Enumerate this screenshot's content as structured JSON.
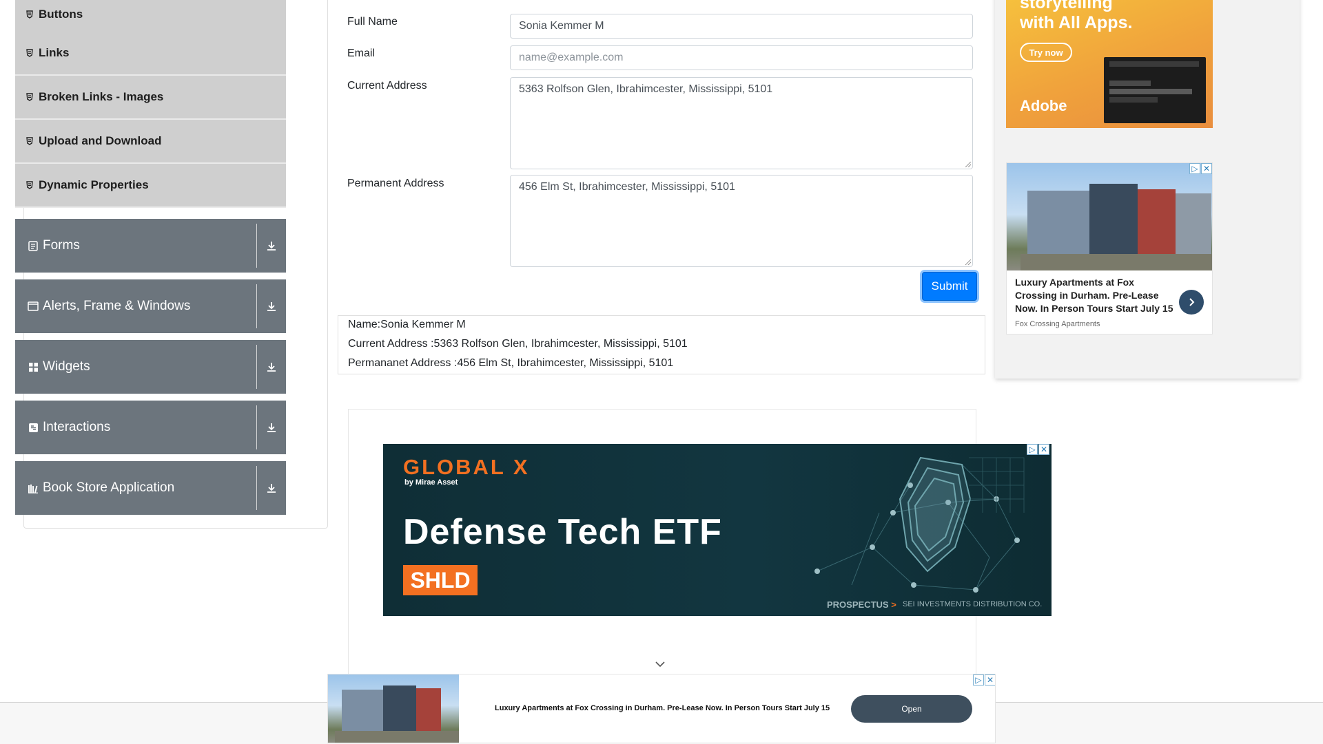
{
  "sidebar": {
    "elements_subitems": [
      {
        "label": "Buttons"
      },
      {
        "label": "Links"
      },
      {
        "label": "Broken Links - Images"
      },
      {
        "label": "Upload and Download"
      },
      {
        "label": "Dynamic Properties"
      }
    ],
    "groups": [
      {
        "label": "Forms",
        "icon": "form-icon"
      },
      {
        "label": "Alerts, Frame & Windows",
        "icon": "window-icon"
      },
      {
        "label": "Widgets",
        "icon": "widgets-icon"
      },
      {
        "label": "Interactions",
        "icon": "interactions-icon"
      },
      {
        "label": "Book Store Application",
        "icon": "bookstore-icon"
      }
    ]
  },
  "form": {
    "full_name_label": "Full Name",
    "full_name_value": "Sonia Kemmer M",
    "email_label": "Email",
    "email_placeholder": "name@example.com",
    "current_address_label": "Current Address",
    "current_address_value": "5363 Rolfson Glen, Ibrahimcester, Mississippi, 5101",
    "permanent_address_label": "Permanent Address",
    "permanent_address_value": "456 Elm St, Ibrahimcester, Mississippi, 5101",
    "submit_label": "Submit"
  },
  "output": {
    "name": "Name:Sonia Kemmer M",
    "current_address": "Current Address :5363 Rolfson Glen, Ibrahimcester, Mississippi, 5101",
    "permanent_address": "Permananet Address :456 Elm St, Ibrahimcester, Mississippi, 5101"
  },
  "ads": {
    "etf": {
      "brand": "GLOBAL X",
      "brand_sub": "by Mirae Asset",
      "headline": "Defense Tech ETF",
      "ticker": "SHLD",
      "prospectus": "PROSPECTUS",
      "prospectus_arrow": ">",
      "distributor": "SEI INVESTMENTS DISTRIBUTION CO."
    },
    "adobe": {
      "line1": "storytelling",
      "line2": "with All Apps.",
      "cta": "Try now",
      "logo": "Adobe"
    },
    "apartments": {
      "title": "Luxury Apartments at Fox Crossing in Durham. Pre-Lease Now. In Person Tours Start July 15",
      "source": "Fox Crossing Apartments"
    },
    "banner": {
      "text": "Luxury Apartments at Fox Crossing in Durham. Pre-Lease Now. In Person Tours Start July 15",
      "button": "Open"
    }
  },
  "colors": {
    "sidebar_group_bg": "#6c757d",
    "sidebar_subitem_bg": "#cfcfcf",
    "submit_bg": "#007bff",
    "etf_accent": "#f37021"
  }
}
